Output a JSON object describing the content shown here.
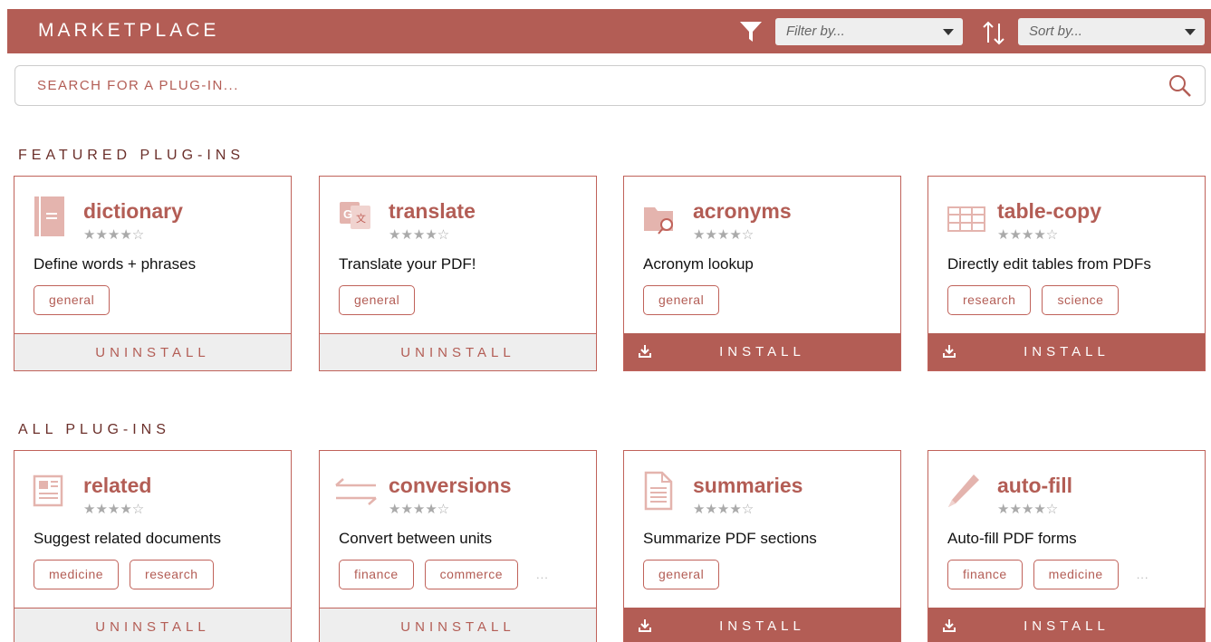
{
  "header": {
    "title": "MARKETPLACE",
    "filter_placeholder": "Filter by...",
    "sort_placeholder": "Sort by..."
  },
  "search": {
    "placeholder": "SEARCH FOR A PLUG-IN..."
  },
  "sections": {
    "featured_title": "FEATURED PLUG-INS",
    "all_title": "ALL PLUG-INS"
  },
  "featured": [
    {
      "name": "dictionary",
      "rating": 4.5,
      "stars": "★★★★☆",
      "description": "Define words + phrases",
      "tags": [
        "general"
      ],
      "more": "",
      "action": "UNINSTALL",
      "icon": "book-icon"
    },
    {
      "name": "translate",
      "rating": 4.5,
      "stars": "★★★★☆",
      "description": "Translate your PDF!",
      "tags": [
        "general"
      ],
      "more": "",
      "action": "UNINSTALL",
      "icon": "translate-icon"
    },
    {
      "name": "acronyms",
      "rating": 4.5,
      "stars": "★★★★☆",
      "description": "Acronym lookup",
      "tags": [
        "general"
      ],
      "more": "",
      "action": "INSTALL",
      "icon": "folder-search-icon"
    },
    {
      "name": "table-copy",
      "rating": 4.5,
      "stars": "★★★★☆",
      "description": "Directly edit tables from PDFs",
      "tags": [
        "research",
        "science"
      ],
      "more": "",
      "action": "INSTALL",
      "icon": "table-icon"
    }
  ],
  "all": [
    {
      "name": "related",
      "rating": 4.5,
      "stars": "★★★★☆",
      "description": "Suggest related documents",
      "tags": [
        "medicine",
        "research"
      ],
      "more": "",
      "action": "UNINSTALL",
      "icon": "newspaper-icon"
    },
    {
      "name": "conversions",
      "rating": 4.5,
      "stars": "★★★★☆",
      "description": "Convert between units",
      "tags": [
        "finance",
        "commerce"
      ],
      "more": "...",
      "action": "UNINSTALL",
      "icon": "swap-arrows-icon"
    },
    {
      "name": "summaries",
      "rating": 4.5,
      "stars": "★★★★☆",
      "description": "Summarize PDF sections",
      "tags": [
        "general"
      ],
      "more": "",
      "action": "INSTALL",
      "icon": "document-icon"
    },
    {
      "name": "auto-fill",
      "rating": 4.5,
      "stars": "★★★★☆",
      "description": "Auto-fill PDF forms",
      "tags": [
        "finance",
        "medicine"
      ],
      "more": "...",
      "action": "INSTALL",
      "icon": "pencil-icon"
    }
  ],
  "colors": {
    "accent": "#b35d55",
    "icon_tint": "#e4b4ae",
    "card_border": "#c0625a",
    "uninstall_bg": "#eeeeee"
  }
}
